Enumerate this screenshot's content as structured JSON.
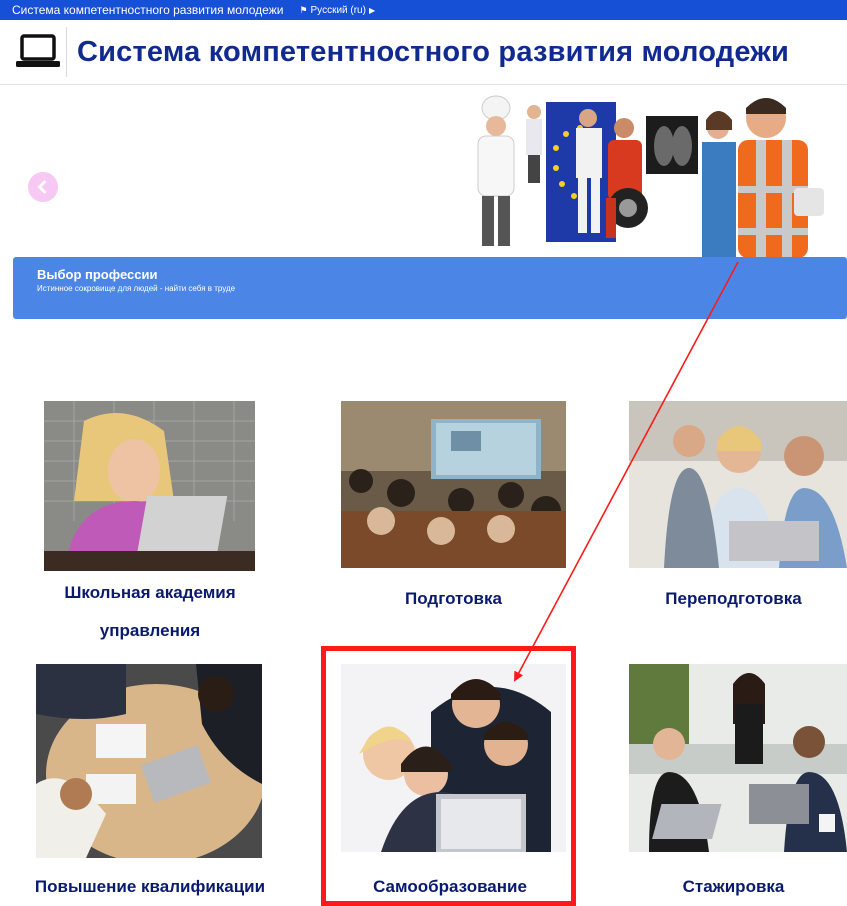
{
  "topbar": {
    "site_name": "Система компетентностного развития молодежи",
    "language": "Русский (ru)"
  },
  "header": {
    "title": "Система компетентностного развития молодежи",
    "icon": "laptop-icon"
  },
  "carousel": {
    "prev_icon": "chevron-left-icon",
    "image": "professions-group-photo"
  },
  "banner": {
    "title": "Выбор профессии",
    "subtitle": "Истинное сокровище для людей - найти себя в труде"
  },
  "cards": [
    {
      "title_line1": "Школьная академия",
      "title_line2": "управления",
      "image": "girl-with-laptop-photo"
    },
    {
      "title": "Подготовка",
      "image": "lecture-hall-photo"
    },
    {
      "title": "Переподготовка",
      "image": "colleagues-at-laptop-photo"
    },
    {
      "title": "Повышение квалификации",
      "image": "meeting-table-topview-photo"
    },
    {
      "title": "Самообразование",
      "image": "team-at-computer-photo"
    },
    {
      "title": "Стажировка",
      "image": "office-group-photo"
    }
  ],
  "colors": {
    "topbar": "#1550d6",
    "title": "#102a8f",
    "banner": "#4b86e6",
    "card_title": "#0a1a6e",
    "highlight": "#ff1a1a"
  }
}
